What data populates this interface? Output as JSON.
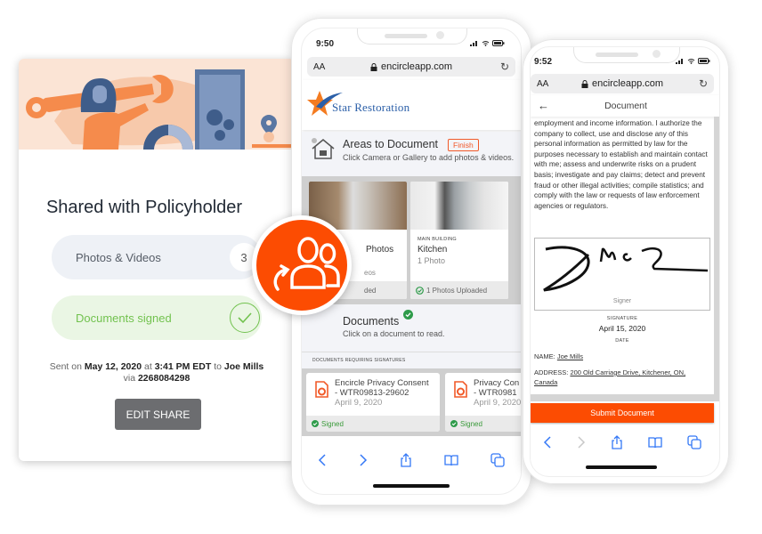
{
  "share_card": {
    "title": "Shared with Policyholder",
    "photos_label": "Photos & Videos",
    "photos_count": "3",
    "documents_label": "Documents signed",
    "sent_prefix": "Sent on",
    "sent_date": "May 12, 2020",
    "sent_at": "at",
    "sent_time": "3:41 PM EDT",
    "sent_to": "to",
    "recipient": "Joe Mills",
    "sent_via": "via",
    "phone": "2268084298",
    "edit_button": "EDIT SHARE"
  },
  "phone_left": {
    "time": "9:50",
    "aa_label": "AA",
    "url": "encircleapp.com",
    "brand": "Star Restoration",
    "areas": {
      "title": "Areas to Document",
      "finish_label": "Finish",
      "subtitle": "Click Camera or Gallery to add photos & videos."
    },
    "tiles": [
      {
        "category": "",
        "name": "Photos",
        "count": "eos",
        "status": "ded"
      },
      {
        "category": "MAIN BUILDING",
        "name": "Kitchen",
        "count": "1 Photo",
        "status": "1 Photos Uploaded"
      }
    ],
    "documents": {
      "title": "Documents",
      "subtitle": "Click on a document to read.",
      "section_label": "DOCUMENTS REQUIRING SIGNATURES",
      "items": [
        {
          "title": "Encircle Privacy Consent",
          "id": "- WTR09813-29602",
          "date": "April 9, 2020",
          "status": "Signed"
        },
        {
          "title": "Privacy Con",
          "id": "- WTR0981",
          "date": "April 9, 2020",
          "status": "Signed"
        }
      ]
    }
  },
  "phone_right": {
    "time": "9:52",
    "aa_label": "AA",
    "url": "encircleapp.com",
    "header_title": "Document",
    "body_text": "employment and income information.  I authorize the company to collect, use and disclose any of this personal information as permitted by law for the purposes necessary to establish and maintain contact with me; assess and underwrite risks on a prudent basis; investigate and pay claims; detect and prevent fraud or other illegal activities; compile statistics; and comply with the law or requests of law enforcement agencies or regulators.",
    "signer_label": "Signer",
    "signature_label": "SIGNATURE",
    "signature_date": "April 15, 2020",
    "date_label": "DATE",
    "name_label": "NAME:",
    "name_value": "Joe Mills",
    "address_label": "ADDRESS:",
    "address_value": "200 Old Carriage Drive, Kitchener, ON, Canada",
    "submit_button": "Submit Document"
  },
  "colors": {
    "accent": "#fc4c02",
    "success": "#72c24f",
    "ios_blue": "#3478f6"
  }
}
